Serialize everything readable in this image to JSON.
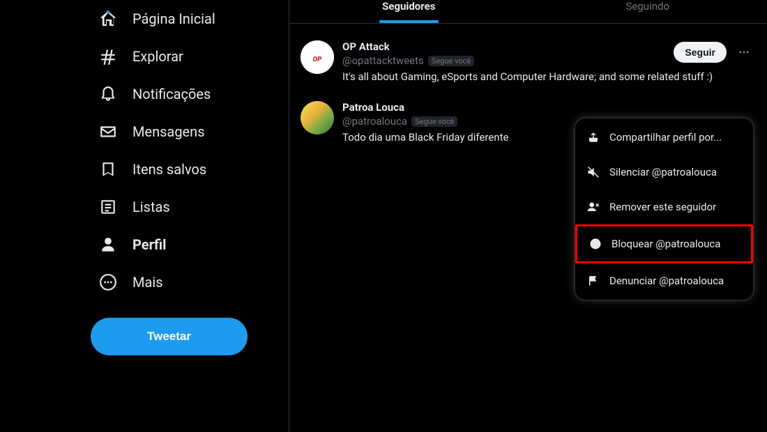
{
  "sidebar": {
    "items": [
      {
        "label": "Página Inicial"
      },
      {
        "label": "Explorar"
      },
      {
        "label": "Notificações"
      },
      {
        "label": "Mensagens"
      },
      {
        "label": "Itens salvos"
      },
      {
        "label": "Listas"
      },
      {
        "label": "Perfil"
      },
      {
        "label": "Mais"
      }
    ],
    "tweet_button": "Tweetar"
  },
  "tabs": {
    "followers": "Seguidores",
    "following": "Seguindo"
  },
  "followers": [
    {
      "name": "OP Attack",
      "handle": "@opattacktweets",
      "follows_you_badge": "Segue você",
      "bio": "It's all about Gaming, eSports and Computer Hardware; and some related stuff :)",
      "follow_button": "Seguir"
    },
    {
      "name": "Patroa Louca",
      "handle": "@patroalouca",
      "follows_you_badge": "Segue você",
      "bio": "Todo dia uma Black Friday diferente"
    }
  ],
  "context_menu": {
    "share": "Compartilhar perfil por...",
    "mute": "Silenciar @patroalouca",
    "remove": "Remover este seguidor",
    "block": "Bloquear @patroalouca",
    "report": "Denunciar @patroalouca"
  }
}
